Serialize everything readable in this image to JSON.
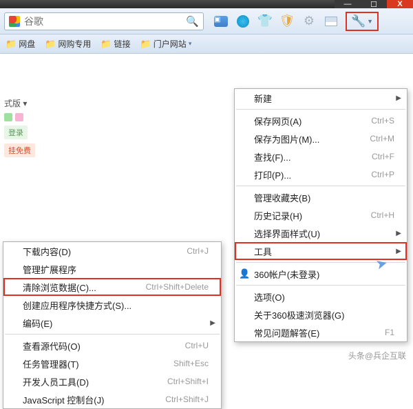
{
  "titlebar": {
    "min": "—",
    "max": "☐",
    "close": "X"
  },
  "addressbar": {
    "placeholder": "谷歌"
  },
  "bookmarks": [
    {
      "label": "网盘"
    },
    {
      "label": "网购专用"
    },
    {
      "label": "链接"
    },
    {
      "label": "门户网站"
    }
  ],
  "snippets": {
    "mode": "式版 ▾",
    "login": "登录",
    "free": "挂免费"
  },
  "main_menu": [
    {
      "label": "新建",
      "shortcut": "",
      "arrow": true
    },
    {
      "sep": true
    },
    {
      "label": "保存网页(A)",
      "shortcut": "Ctrl+S"
    },
    {
      "label": "保存为图片(M)...",
      "shortcut": "Ctrl+M"
    },
    {
      "label": "查找(F)...",
      "shortcut": "Ctrl+F"
    },
    {
      "label": "打印(P)...",
      "shortcut": "Ctrl+P"
    },
    {
      "sep": true
    },
    {
      "label": "管理收藏夹(B)",
      "shortcut": ""
    },
    {
      "label": "历史记录(H)",
      "shortcut": "Ctrl+H"
    },
    {
      "label": "选择界面样式(U)",
      "shortcut": "",
      "arrow": true
    },
    {
      "label": "工具",
      "shortcut": "",
      "arrow": true,
      "highlight": true
    },
    {
      "sep": true
    },
    {
      "label": "360帐户(未登录)",
      "shortcut": "",
      "icon": "👤"
    },
    {
      "sep": true
    },
    {
      "label": "选项(O)",
      "shortcut": ""
    },
    {
      "label": "关于360极速浏览器(G)",
      "shortcut": ""
    },
    {
      "label": "常见问题解答(E)",
      "shortcut": "F1"
    }
  ],
  "sub_menu": [
    {
      "label": "下载内容(D)",
      "shortcut": "Ctrl+J"
    },
    {
      "label": "管理扩展程序",
      "shortcut": ""
    },
    {
      "label": "清除浏览数据(C)...",
      "shortcut": "Ctrl+Shift+Delete",
      "highlight": true
    },
    {
      "label": "创建应用程序快捷方式(S)...",
      "shortcut": ""
    },
    {
      "label": "编码(E)",
      "shortcut": "",
      "arrow": true
    },
    {
      "sep": true
    },
    {
      "label": "查看源代码(O)",
      "shortcut": "Ctrl+U"
    },
    {
      "label": "任务管理器(T)",
      "shortcut": "Shift+Esc"
    },
    {
      "label": "开发人员工具(D)",
      "shortcut": "Ctrl+Shift+I"
    },
    {
      "label": "JavaScript 控制台(J)",
      "shortcut": "Ctrl+Shift+J"
    }
  ],
  "watermark": "头条@兵企互联"
}
